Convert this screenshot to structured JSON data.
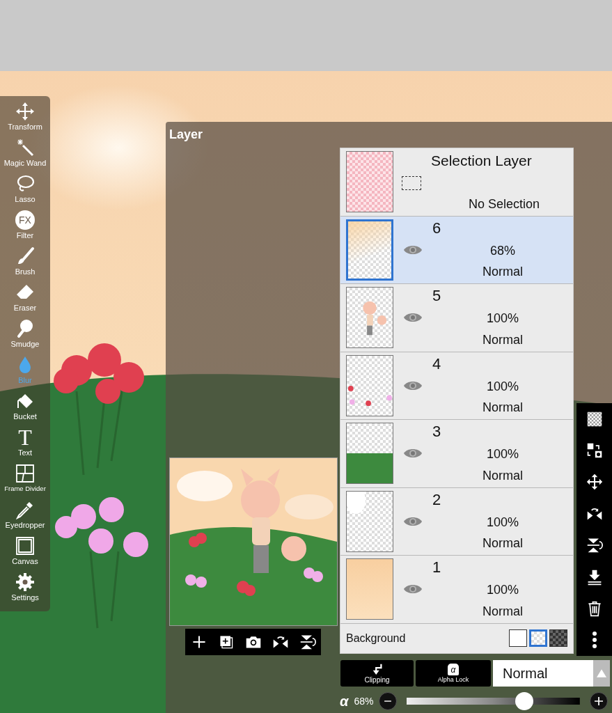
{
  "layer_window": {
    "title": "Layer"
  },
  "tools": [
    {
      "label": "Transform",
      "kind": "transform",
      "selected": false
    },
    {
      "label": "Magic Wand",
      "kind": "wand",
      "selected": false
    },
    {
      "label": "Lasso",
      "kind": "lasso",
      "selected": false
    },
    {
      "label": "Filter",
      "kind": "filter",
      "glyph": "FX",
      "selected": false
    },
    {
      "label": "Brush",
      "kind": "brush",
      "selected": false
    },
    {
      "label": "Eraser",
      "kind": "eraser",
      "selected": false
    },
    {
      "label": "Smudge",
      "kind": "smudge",
      "selected": false
    },
    {
      "label": "Blur",
      "kind": "blur",
      "selected": true
    },
    {
      "label": "Bucket",
      "kind": "bucket",
      "selected": false
    },
    {
      "label": "Text",
      "kind": "text",
      "glyph": "T",
      "selected": false
    },
    {
      "label": "Frame Divider",
      "kind": "frame",
      "selected": false
    },
    {
      "label": "Eyedropper",
      "kind": "eyedropper",
      "selected": false
    },
    {
      "label": "Canvas",
      "kind": "canvas",
      "selected": false
    },
    {
      "label": "Settings",
      "kind": "settings",
      "selected": false
    }
  ],
  "selection_layer": {
    "title": "Selection Layer",
    "status": "No Selection"
  },
  "layers": [
    {
      "name": "6",
      "opacity": "68%",
      "blend": "Normal",
      "visible": true,
      "selected": true,
      "kind": "peach-fade"
    },
    {
      "name": "5",
      "opacity": "100%",
      "blend": "Normal",
      "visible": true,
      "selected": false,
      "kind": "character"
    },
    {
      "name": "4",
      "opacity": "100%",
      "blend": "Normal",
      "visible": true,
      "selected": false,
      "kind": "flowers"
    },
    {
      "name": "3",
      "opacity": "100%",
      "blend": "Normal",
      "visible": true,
      "selected": false,
      "kind": "hill"
    },
    {
      "name": "2",
      "opacity": "100%",
      "blend": "Normal",
      "visible": true,
      "selected": false,
      "kind": "clouds"
    },
    {
      "name": "1",
      "opacity": "100%",
      "blend": "Normal",
      "visible": true,
      "selected": false,
      "kind": "peach"
    }
  ],
  "background": {
    "label": "Background",
    "options": [
      {
        "kind": "white",
        "selected": false
      },
      {
        "kind": "transparent",
        "selected": true
      },
      {
        "kind": "dark",
        "selected": false
      }
    ]
  },
  "layer_actions": [
    {
      "kind": "checker"
    },
    {
      "kind": "swap"
    },
    {
      "kind": "move"
    },
    {
      "kind": "flip-h"
    },
    {
      "kind": "flip-v"
    },
    {
      "kind": "merge-down"
    },
    {
      "kind": "trash"
    },
    {
      "kind": "more"
    }
  ],
  "preview_actions": [
    {
      "kind": "add"
    },
    {
      "kind": "add-layer"
    },
    {
      "kind": "camera"
    },
    {
      "kind": "flip-h"
    },
    {
      "kind": "flip-v"
    }
  ],
  "buttons": [
    {
      "label": "Clipping",
      "kind": "clipping"
    },
    {
      "label": "Alpha Lock",
      "kind": "alpha-lock",
      "glyph": "α"
    }
  ],
  "blend_mode": {
    "value": "Normal"
  },
  "opacity": {
    "symbol": "α",
    "reading": "68%",
    "level": 0.68
  }
}
